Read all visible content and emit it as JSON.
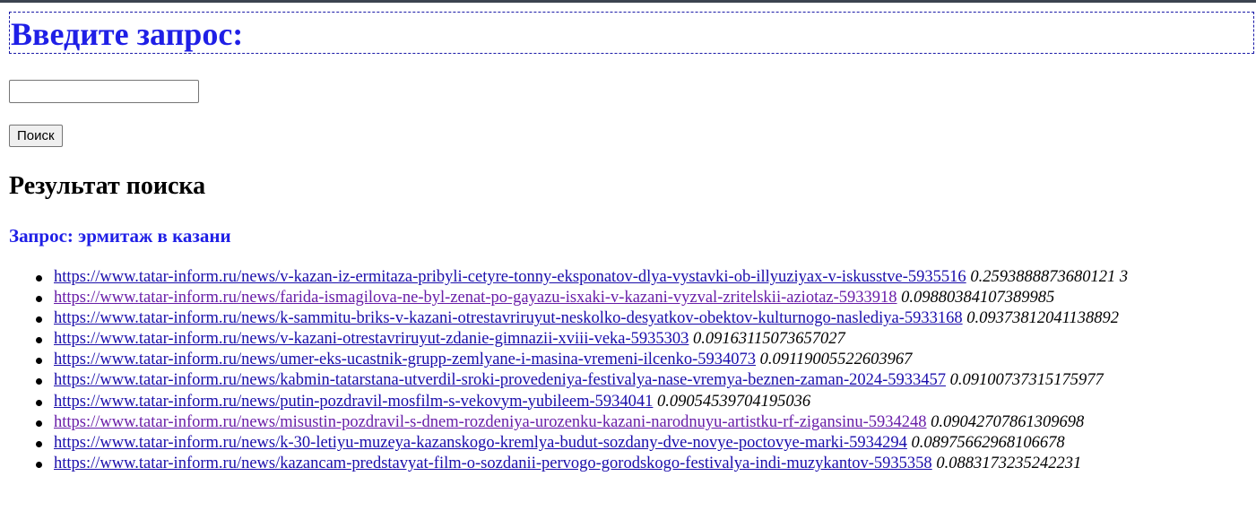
{
  "page": {
    "heading": "Введите запрос:",
    "search_input": {
      "value": "",
      "placeholder": ""
    },
    "search_button": "Поиск",
    "results_heading": "Результат поиска",
    "query_label": "Запрос: эрмитаж в казани"
  },
  "results": [
    {
      "url": "https://www.tatar-inform.ru/news/v-kazan-iz-ermitaza-pribyli-cetyre-tonny-eksponatov-dlya-vystavki-ob-illyuziyax-v-iskusstve-5935516",
      "score": "0.2593888873680121 3",
      "visited": false
    },
    {
      "url": "https://www.tatar-inform.ru/news/farida-ismagilova-ne-byl-zenat-po-gayazu-isxaki-v-kazani-vyzval-zritelskii-aziotaz-5933918",
      "score": "0.09880384107389985",
      "visited": true
    },
    {
      "url": "https://www.tatar-inform.ru/news/k-sammitu-briks-v-kazani-otrestavriruyut-neskolko-desyatkov-obektov-kulturnogo-naslediya-5933168",
      "score": "0.09373812041138892",
      "visited": false
    },
    {
      "url": "https://www.tatar-inform.ru/news/v-kazani-otrestavriruyut-zdanie-gimnazii-xviii-veka-5935303",
      "score": "0.09163115073657027",
      "visited": false
    },
    {
      "url": "https://www.tatar-inform.ru/news/umer-eks-ucastnik-grupp-zemlyane-i-masina-vremeni-ilcenko-5934073",
      "score": "0.09119005522603967",
      "visited": false
    },
    {
      "url": "https://www.tatar-inform.ru/news/kabmin-tatarstana-utverdil-sroki-provedeniya-festivalya-nase-vremya-beznen-zaman-2024-5933457",
      "score": "0.09100737315175977",
      "visited": false
    },
    {
      "url": "https://www.tatar-inform.ru/news/putin-pozdravil-mosfilm-s-vekovym-yubileem-5934041",
      "score": "0.09054539704195036",
      "visited": false
    },
    {
      "url": "https://www.tatar-inform.ru/news/misustin-pozdravil-s-dnem-rozdeniya-urozenku-kazani-narodnuyu-artistku-rf-zigansinu-5934248",
      "score": "0.09042707861309698",
      "visited": true
    },
    {
      "url": "https://www.tatar-inform.ru/news/k-30-letiyu-muzeya-kazanskogo-kremlya-budut-sozdany-dve-novye-poctovye-marki-5934294",
      "score": "0.08975662968106678",
      "visited": false
    },
    {
      "url": "https://www.tatar-inform.ru/news/kazancam-predstavyat-film-o-sozdanii-pervogo-gorodskogo-festivalya-indi-muzykantov-5935358",
      "score": "0.0883173235242231",
      "visited": false
    }
  ]
}
